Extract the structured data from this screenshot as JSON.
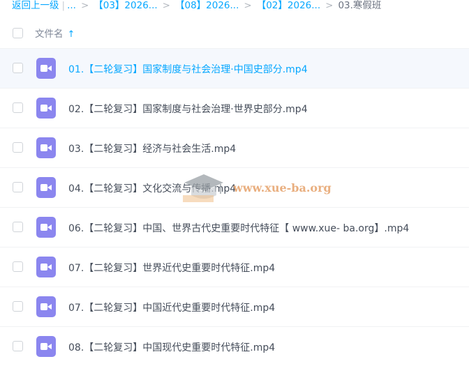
{
  "breadcrumb": {
    "back": "返回上一级",
    "pipe": "|",
    "ellipsis": "...",
    "sep": ">",
    "items": [
      "【03】2026...",
      "【08】2026...",
      "【02】2026..."
    ],
    "current": "03.寒假班"
  },
  "table": {
    "header": "文件名",
    "sort_icon": "arrow-up-icon"
  },
  "files": [
    "01.【二轮复习】国家制度与社会治理·中国史部分.mp4",
    "02.【二轮复习】国家制度与社会治理·世界史部分.mp4",
    "03.【二轮复习】经济与社会生活.mp4",
    "04.【二轮复习】文化交流与传播.mp4",
    "06.【二轮复习】中国、世界古代史重要时代特征【 www.xue- ba.org】.mp4",
    "07.【二轮复习】世界近代史重要时代特征.mp4",
    "07.【二轮复习】中国近代史重要时代特征.mp4",
    "08.【二轮复习】中国现代史重要时代特征.mp4"
  ],
  "watermark": {
    "text": "www.xue-ba.org"
  },
  "colors": {
    "accent": "#06a7ff",
    "video_icon": "#8b86ef"
  }
}
